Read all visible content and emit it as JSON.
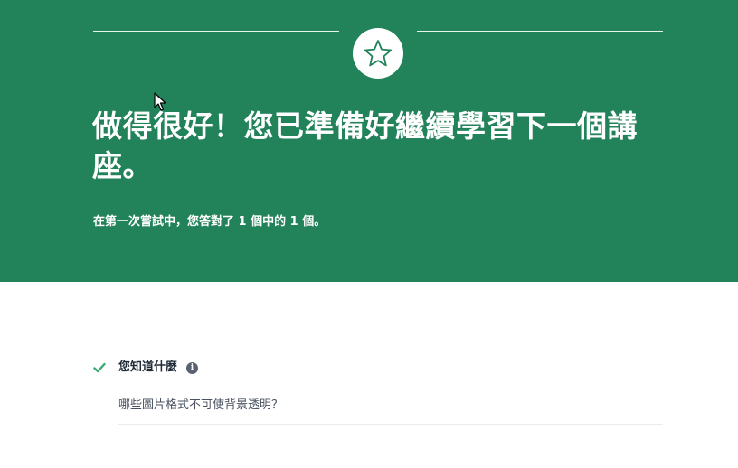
{
  "banner": {
    "headline": "做得很好！您已準備好繼續學習下一個講座。",
    "score_text": "在第一次嘗試中，您答對了 1 個中的 1 個。",
    "badge_icon": "star-icon"
  },
  "results": {
    "section_title": "您知道什麼",
    "info_icon": "info-icon",
    "info_glyph": "i",
    "status_icon": "check-icon",
    "question": "哪些圖片格式不可使背景透明？"
  },
  "colors": {
    "banner_bg": "#22825a",
    "check": "#3aa977",
    "text_dark": "#1f2a36"
  }
}
